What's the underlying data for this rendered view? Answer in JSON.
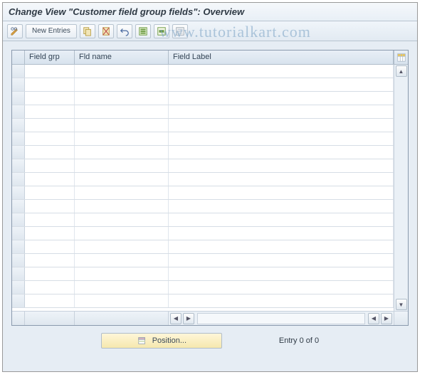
{
  "title": "Change View \"Customer field group fields\": Overview",
  "toolbar": {
    "new_entries_label": "New Entries"
  },
  "watermark": "www.tutorialkart.com",
  "grid": {
    "columns": {
      "field_grp": "Field grp",
      "fld_name": "Fld name",
      "field_label": "Field Label"
    },
    "row_count": 18
  },
  "footer": {
    "position_label": "Position...",
    "entry_status": "Entry 0 of 0"
  }
}
